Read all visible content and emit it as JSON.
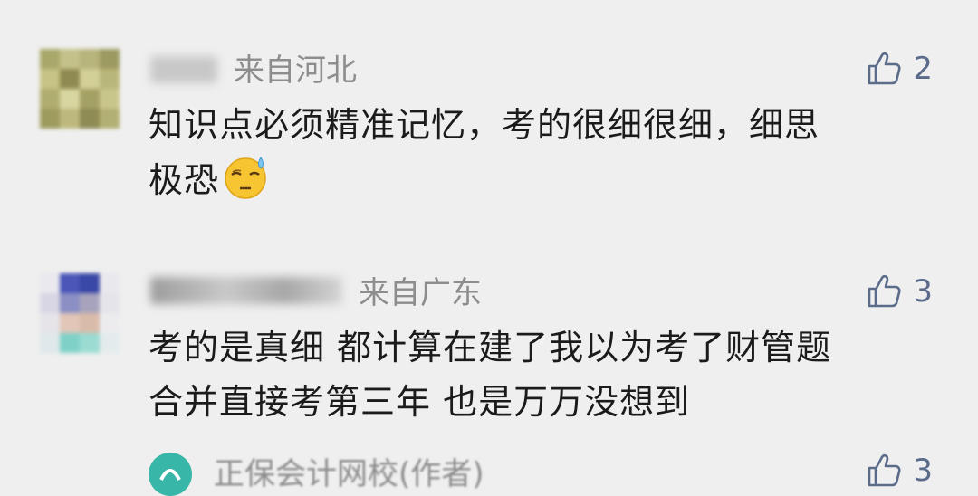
{
  "comments": [
    {
      "region": "来自河北",
      "likes": "2",
      "text_line1": "知识点必须精准记忆，考的很细很细，细思",
      "text_line2": "极恐",
      "emoji": "sweat-smile-emoji"
    },
    {
      "region": "来自广东",
      "likes": "3",
      "text_line1": "考的是真细 都计算在建了我以为考了财管题",
      "text_line2": "合并直接考第三年 也是万万没想到"
    }
  ],
  "reply": {
    "author": "正保会计网校(作者)",
    "likes": "3"
  },
  "colors": {
    "background": "#efefef",
    "text": "#1b1b1b",
    "meta": "#8d8d8d",
    "like": "#5b6b8a"
  },
  "icons": [
    "thumbs-up-icon",
    "author-logo-icon"
  ]
}
